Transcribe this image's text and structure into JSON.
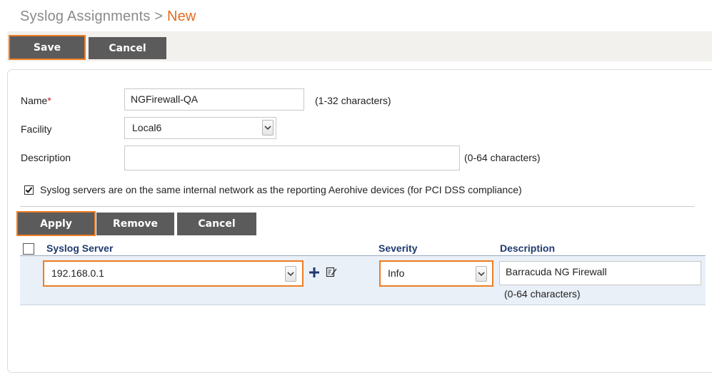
{
  "page": {
    "title_prefix": "Syslog Assignments > ",
    "title_suffix": "New"
  },
  "toolbar": {
    "save_label": "Save",
    "cancel_label": "Cancel"
  },
  "form": {
    "name_label": "Name",
    "name_required_mark": "*",
    "name_value": "NGFirewall-QA",
    "name_hint": "(1-32 characters)",
    "facility_label": "Facility",
    "facility_value": "Local6",
    "description_label": "Description",
    "description_value": "",
    "description_hint": "(0-64 characters)",
    "pci_checkbox_checked": true,
    "pci_checkbox_label": "Syslog servers are on the same internal network as the reporting Aerohive devices (for PCI DSS compliance)"
  },
  "server_actions": {
    "apply_label": "Apply",
    "remove_label": "Remove",
    "cancel_label": "Cancel"
  },
  "server_table": {
    "columns": [
      "Syslog Server",
      "Severity",
      "Description"
    ],
    "row": {
      "server": "192.168.0.1",
      "severity": "Info",
      "description": "Barracuda NG Firewall",
      "description_hint": "(0-64 characters)"
    }
  },
  "colors": {
    "highlight": "#ee7d22",
    "button_bg": "#5b5b5b",
    "header_text": "#1f3a70",
    "row_bg": "#eaf0f8",
    "title_accent": "#e36c1d"
  }
}
